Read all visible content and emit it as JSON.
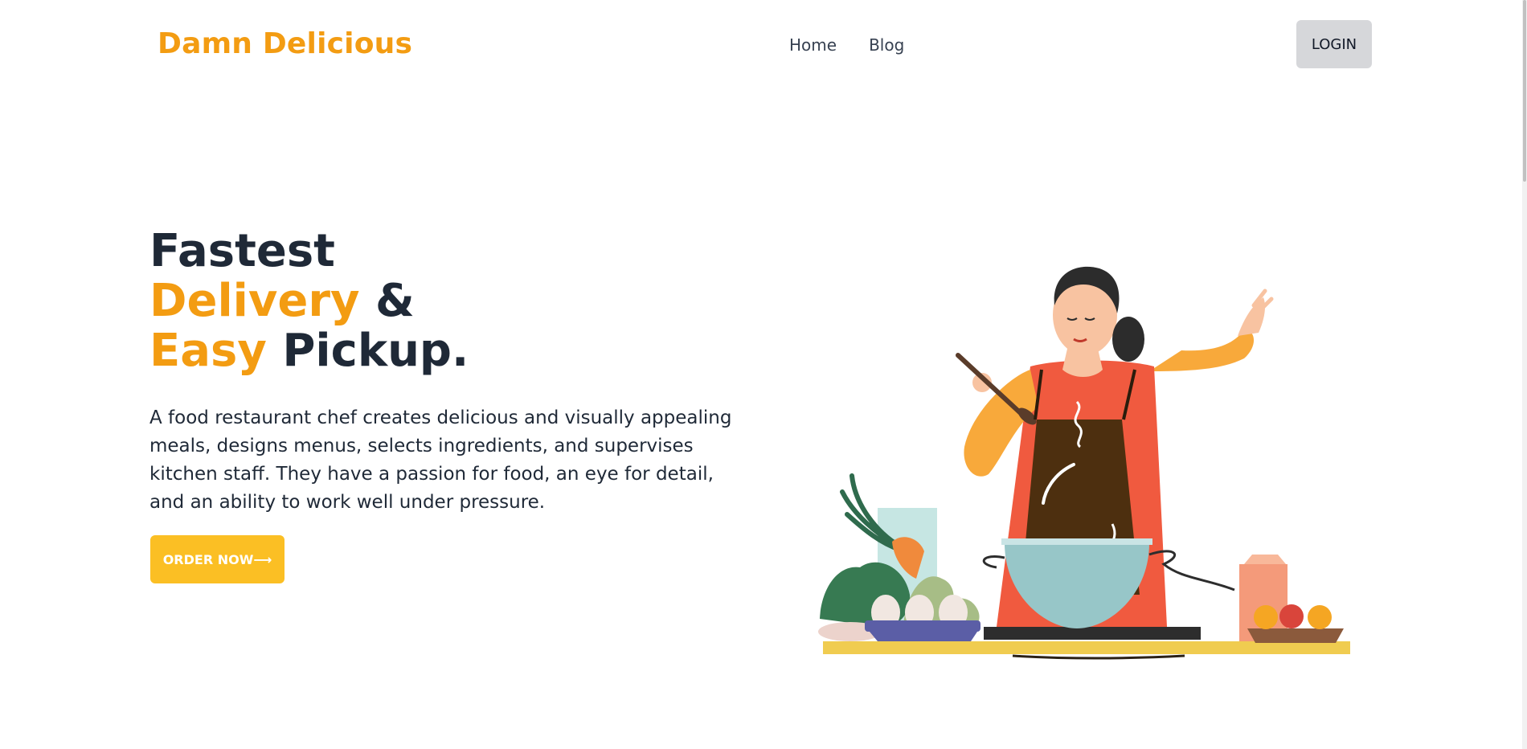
{
  "header": {
    "brand": "Damn Delicious",
    "nav": [
      {
        "label": "Home"
      },
      {
        "label": "Blog"
      }
    ],
    "login_label": "LOGIN"
  },
  "hero": {
    "title_line1": "Fastest",
    "title_line2_accent": "Delivery",
    "title_line2_rest": " &",
    "title_line3_accent": "Easy",
    "title_line3_rest": " Pickup.",
    "description": "A food restaurant chef creates delicious and visually appealing meals, designs menus, selects ingredients, and supervises kitchen staff. They have a passion for food, an eye for detail, and an ability to work well under pressure.",
    "cta_label": "ORDER NOW",
    "cta_icon": "arrow-right-icon"
  },
  "illustration": {
    "subject": "chef-cooking-illustration"
  },
  "colors": {
    "accent": "#f39c12",
    "cta": "#fbbf24",
    "text": "#1f2937",
    "login_bg": "#d6d7da"
  }
}
